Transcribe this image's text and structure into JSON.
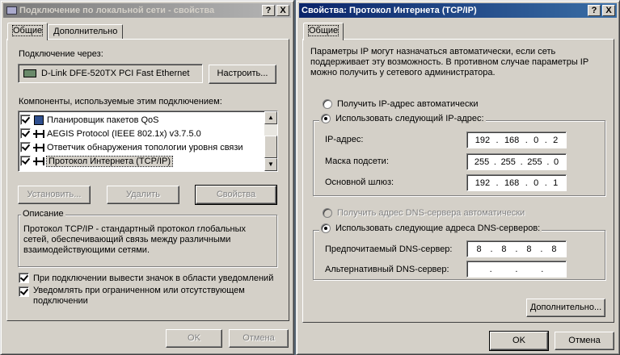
{
  "left_window": {
    "title": "Подключение по локальной сети - свойства",
    "help_button": "?",
    "close_button": "X",
    "tabs": [
      "Общие",
      "Дополнительно"
    ],
    "connect_using_label": "Подключение через:",
    "adapter_name": "D-Link DFE-520TX PCI Fast Ethernet",
    "configure_button": "Настроить...",
    "components_label": "Компоненты, используемые этим подключением:",
    "components": [
      {
        "label": "Планировщик пакетов QoS",
        "checked": true,
        "icon": "qos-icon"
      },
      {
        "label": "AEGIS Protocol (IEEE 802.1x) v3.7.5.0",
        "checked": true,
        "icon": "network-protocol-icon"
      },
      {
        "label": "Ответчик обнаружения топологии уровня связи",
        "checked": true,
        "icon": "network-protocol-icon"
      },
      {
        "label": "Протокол Интернета (TCP/IP)",
        "checked": true,
        "icon": "network-protocol-icon",
        "selected": true
      }
    ],
    "install_button": "Установить...",
    "uninstall_button": "Удалить",
    "properties_button": "Свойства",
    "description_legend": "Описание",
    "description_text": "Протокол TCP/IP - стандартный протокол глобальных сетей, обеспечивающий связь между различными взаимодействующими сетями.",
    "show_icon_label": "При подключении вывести значок в области уведомлений",
    "show_icon_checked": true,
    "notify_label": "Уведомлять при ограниченном или отсутствующем подключении",
    "notify_checked": true,
    "ok_button": "OK",
    "cancel_button": "Отмена"
  },
  "right_window": {
    "title": "Свойства: Протокол Интернета (TCP/IP)",
    "help_button": "?",
    "close_button": "X",
    "tabs": [
      "Общие"
    ],
    "intro_text": "Параметры IP могут назначаться автоматически, если сеть поддерживает эту возможность. В противном случае параметры IP можно получить у сетевого администратора.",
    "ip_auto_label": "Получить IP-адрес автоматически",
    "ip_manual_label": "Использовать следующий IP-адрес:",
    "ip_mode": "manual",
    "ip_address_label": "IP-адрес:",
    "ip_address": [
      "192",
      "168",
      "0",
      "2"
    ],
    "subnet_label": "Маска подсети:",
    "subnet_mask": [
      "255",
      "255",
      "255",
      "0"
    ],
    "gateway_label": "Основной шлюз:",
    "gateway": [
      "192",
      "168",
      "0",
      "1"
    ],
    "dns_auto_label": "Получить адрес DNS-сервера автоматически",
    "dns_manual_label": "Использовать следующие адреса DNS-серверов:",
    "dns_mode": "manual",
    "preferred_dns_label": "Предпочитаемый DNS-сервер:",
    "preferred_dns": [
      "8",
      "8",
      "8",
      "8"
    ],
    "alternate_dns_label": "Альтернативный DNS-сервер:",
    "alternate_dns": [
      "",
      "",
      "",
      ""
    ],
    "ip_dot": ".",
    "advanced_button": "Дополнительно...",
    "ok_button": "OK",
    "cancel_button": "Отмена"
  },
  "colors": {
    "active_title": "#0a246a",
    "inactive_title": "#7b7b7b",
    "face": "#d4d0c8",
    "selection": "#0a246a"
  }
}
